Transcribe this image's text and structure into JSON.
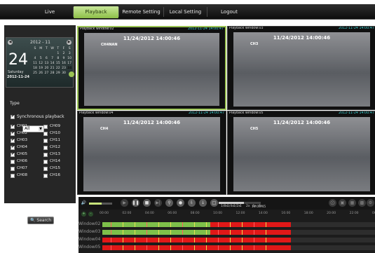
{
  "nav": {
    "tabs": [
      {
        "label": "Live"
      },
      {
        "label": "Playback"
      },
      {
        "label": "Remote Setting"
      },
      {
        "label": "Local Setting"
      },
      {
        "label": "Logout"
      }
    ],
    "active_tab": "Playback"
  },
  "calendar": {
    "month_label": "2012 - 11",
    "day": "24",
    "weekday": "Saturday",
    "date": "2012-11-24",
    "weekday_headers": [
      "S",
      "M",
      "T",
      "W",
      "T",
      "F",
      "S"
    ],
    "rows": [
      [
        "",
        "",
        "",
        "",
        "1",
        "2",
        "3"
      ],
      [
        "4",
        "5",
        "6",
        "7",
        "8",
        "9",
        "10"
      ],
      [
        "11",
        "12",
        "13",
        "14",
        "15",
        "16",
        "17"
      ],
      [
        "18",
        "19",
        "20",
        "21",
        "22",
        "23",
        "24"
      ],
      [
        "25",
        "26",
        "27",
        "28",
        "29",
        "30",
        ""
      ]
    ],
    "selected_day": "24"
  },
  "filter": {
    "type_label": "Type",
    "type_value": "All",
    "sync_label": "Synchronous playback",
    "sync_checked": true
  },
  "channels": [
    {
      "label": "CH01",
      "checked": true
    },
    {
      "label": "CH09",
      "checked": false
    },
    {
      "label": "CH02",
      "checked": true
    },
    {
      "label": "CH10",
      "checked": false
    },
    {
      "label": "CH03",
      "checked": true
    },
    {
      "label": "CH11",
      "checked": false
    },
    {
      "label": "CH04",
      "checked": true
    },
    {
      "label": "CH12",
      "checked": false
    },
    {
      "label": "CH05",
      "checked": true
    },
    {
      "label": "CH13",
      "checked": false
    },
    {
      "label": "CH06",
      "checked": false
    },
    {
      "label": "CH14",
      "checked": false
    },
    {
      "label": "CH07",
      "checked": false
    },
    {
      "label": "CH15",
      "checked": false
    },
    {
      "label": "CH08",
      "checked": false
    },
    {
      "label": "CH16",
      "checked": false
    }
  ],
  "search_button": "Search",
  "windows": [
    {
      "title": "Playback window:02",
      "timestamp": "2012-11-24 14:00:47",
      "osd": "11/24/2012 14:00:46",
      "cam": "CH4NAN",
      "selected": true
    },
    {
      "title": "Playback window:03",
      "timestamp": "2012-11-24 14:00:47",
      "osd": "11/24/2012 14:00:46",
      "cam": "CH3",
      "selected": false
    },
    {
      "title": "Playback window:04",
      "timestamp": "2012-11-24 14:00:47",
      "osd": "11/24/2012 14:00:46",
      "cam": "CH4",
      "selected": false
    },
    {
      "title": "Playback window:05",
      "timestamp": "2012-11-24 14:00:47",
      "osd": "11/24/2012 14:00:46",
      "cam": "CH5",
      "selected": false
    }
  ],
  "controls": {
    "speed_labels": [
      "1/8x",
      "1/4x",
      "1/2x",
      "1",
      "2x",
      "4x",
      "8x"
    ],
    "current_time": "14:00:45",
    "volume_level": 0.55,
    "speed_level": 0.6
  },
  "timeline": {
    "hours": [
      "00:00",
      "02:00",
      "04:00",
      "06:00",
      "08:00",
      "10:00",
      "12:00",
      "14:00",
      "16:00",
      "18:00",
      "20:00",
      "22:00",
      "00:00"
    ],
    "rows": [
      {
        "label": "Window02",
        "segments": [
          {
            "from": 0,
            "to": 9.5,
            "color": "#7ec04a"
          },
          {
            "from": 9.5,
            "to": 16.6,
            "color": "#e01818"
          }
        ]
      },
      {
        "label": "Window03",
        "segments": [
          {
            "from": 0,
            "to": 9.5,
            "color": "#7ec04a"
          },
          {
            "from": 9.5,
            "to": 16.6,
            "color": "#e01818"
          }
        ]
      },
      {
        "label": "Window04",
        "segments": [
          {
            "from": 0,
            "to": 16.6,
            "color": "#e01818"
          }
        ]
      },
      {
        "label": "Window05",
        "segments": [
          {
            "from": 0,
            "to": 16.6,
            "color": "#e01818"
          }
        ]
      }
    ],
    "colors": {
      "normal": "#7ec04a",
      "alarm": "#e01818"
    }
  }
}
